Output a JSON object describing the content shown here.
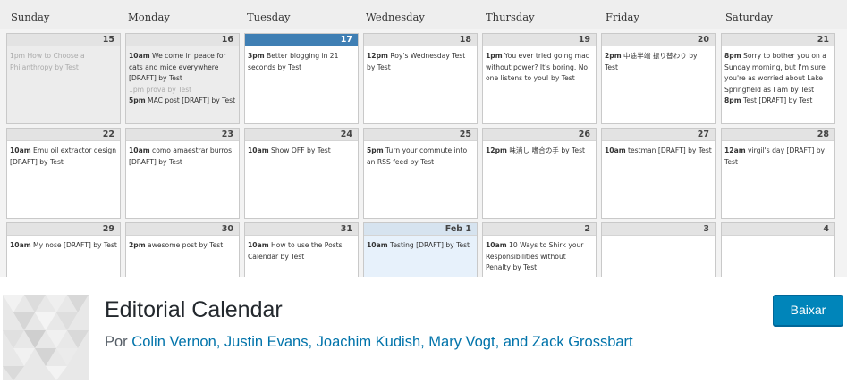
{
  "calendar": {
    "day_names": [
      "Sunday",
      "Monday",
      "Tuesday",
      "Wednesday",
      "Thursday",
      "Friday",
      "Saturday"
    ],
    "weeks": [
      [
        {
          "day": "15",
          "state": "past",
          "posts": [
            {
              "time": "1pm",
              "text": "How to Choose a Philanthropy by Test",
              "faded": true
            }
          ]
        },
        {
          "day": "16",
          "state": "past",
          "posts": [
            {
              "time": "10am",
              "text": "We come in peace for cats and mice everywhere [DRAFT] by Test"
            },
            {
              "time": "1pm",
              "text": "prova by Test",
              "faded": true
            },
            {
              "time": "5pm",
              "text": "MAC post [DRAFT] by Test"
            }
          ]
        },
        {
          "day": "17",
          "state": "today",
          "posts": [
            {
              "time": "3pm",
              "text": "Better blogging in 21 seconds by Test"
            }
          ]
        },
        {
          "day": "18",
          "state": "",
          "posts": [
            {
              "time": "12pm",
              "text": "Roy's Wednesday Test by Test"
            }
          ]
        },
        {
          "day": "19",
          "state": "",
          "posts": [
            {
              "time": "1pm",
              "text": "You ever tried going mad without power? It's boring. No one listens to you! by Test"
            }
          ]
        },
        {
          "day": "20",
          "state": "",
          "posts": [
            {
              "time": "2pm",
              "text": "中途半端 振り替わり by Test"
            }
          ]
        },
        {
          "day": "21",
          "state": "",
          "posts": [
            {
              "time": "8pm",
              "text": "Sorry to bother you on a Sunday morning, but I'm sure you're as worried about Lake Springfield as I am by Test"
            },
            {
              "time": "8pm",
              "text": "Test [DRAFT] by Test"
            }
          ]
        }
      ],
      [
        {
          "day": "22",
          "state": "",
          "posts": [
            {
              "time": "10am",
              "text": "Emu oil extractor design [DRAFT] by Test"
            }
          ]
        },
        {
          "day": "23",
          "state": "",
          "posts": [
            {
              "time": "10am",
              "text": "como amaestrar burros [DRAFT] by Test"
            }
          ]
        },
        {
          "day": "24",
          "state": "",
          "posts": [
            {
              "time": "10am",
              "text": "Show OFF by Test"
            }
          ]
        },
        {
          "day": "25",
          "state": "",
          "posts": [
            {
              "time": "5pm",
              "text": "Turn your commute into an RSS feed by Test"
            }
          ]
        },
        {
          "day": "26",
          "state": "",
          "posts": [
            {
              "time": "12pm",
              "text": "味消し 嗜合の手 by Test"
            }
          ]
        },
        {
          "day": "27",
          "state": "",
          "posts": [
            {
              "time": "10am",
              "text": "testman [DRAFT] by Test"
            }
          ]
        },
        {
          "day": "28",
          "state": "",
          "posts": [
            {
              "time": "12am",
              "text": "virgil's day [DRAFT] by Test"
            }
          ]
        }
      ],
      [
        {
          "day": "29",
          "state": "",
          "posts": [
            {
              "time": "10am",
              "text": "My nose [DRAFT] by Test"
            }
          ]
        },
        {
          "day": "30",
          "state": "",
          "posts": [
            {
              "time": "2pm",
              "text": "awesome post by Test"
            }
          ]
        },
        {
          "day": "31",
          "state": "",
          "posts": [
            {
              "time": "10am",
              "text": "How to use the Posts Calendar by Test"
            }
          ]
        },
        {
          "day": "Feb 1",
          "state": "sel",
          "posts": [
            {
              "time": "10am",
              "text": "Testing [DRAFT] by Test"
            }
          ]
        },
        {
          "day": "2",
          "state": "",
          "posts": [
            {
              "time": "10am",
              "text": "10 Ways to Shirk your Responsibilities without Penalty by Test"
            }
          ]
        },
        {
          "day": "3",
          "state": "",
          "posts": []
        },
        {
          "day": "4",
          "state": "",
          "posts": []
        }
      ]
    ]
  },
  "plugin": {
    "title": "Editorial Calendar",
    "by_prefix": "Por",
    "authors": "Colin Vernon, Justin Evans, Joachim Kudish, Mary Vogt, and Zack Grossbart",
    "download_label": "Baixar",
    "icon_name": "plugin-icon"
  },
  "colors": {
    "download_bg": "#0085ba",
    "link": "#0073aa",
    "today_header": "#3f7fb4"
  }
}
